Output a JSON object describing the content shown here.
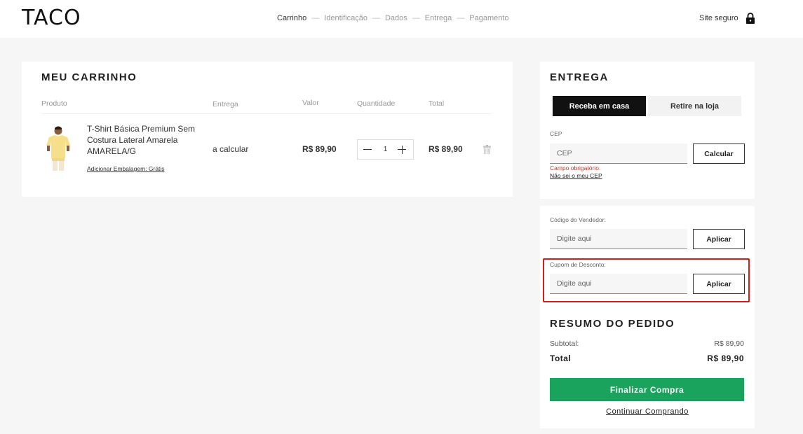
{
  "header": {
    "logo": "TACO",
    "steps": [
      "Carrinho",
      "Identificação",
      "Dados",
      "Entrega",
      "Pagamento"
    ],
    "secure_label": "Site seguro",
    "lock_icon": "lock-icon"
  },
  "cart": {
    "title": "MEU CARRINHO",
    "columns": {
      "product": "Produto",
      "delivery": "Entrega",
      "value": "Valor",
      "quantity": "Quantidade",
      "total": "Total"
    },
    "item": {
      "name": "T-Shirt Básica Premium Sem Costura Lateral Amarela AMARELA/G",
      "packaging_link": "Adicionar Embalagem: Grátis",
      "delivery": "a calcular",
      "value": "R$ 89,90",
      "quantity": "1",
      "total": "R$ 89,90"
    }
  },
  "shipping": {
    "title": "ENTREGA",
    "tab_home": "Receba em casa",
    "tab_store": "Retire na loja",
    "cep_label": "CEP",
    "cep_placeholder": "CEP",
    "calc_button": "Calcular",
    "error": "Campo obrigatório.",
    "dont_know_link": "Não sei o meu CEP"
  },
  "codes": {
    "seller_label": "Código do Vendedor:",
    "seller_placeholder": "Digite aqui",
    "seller_button": "Aplicar",
    "coupon_label": "Cupom de Desconto:",
    "coupon_placeholder": "Digite aqui",
    "coupon_button": "Aplicar"
  },
  "summary": {
    "title": "RESUMO DO PEDIDO",
    "subtotal_label": "Subtotal:",
    "subtotal_value": "R$ 89,90",
    "total_label": "Total",
    "total_value": "R$ 89,90",
    "finish_button": "Finalizar Compra",
    "continue_link": "Continuar Comprando"
  },
  "colors": {
    "accent_green": "#1aa35d",
    "highlight_red": "#d61c1c",
    "tab_active": "#111111"
  }
}
